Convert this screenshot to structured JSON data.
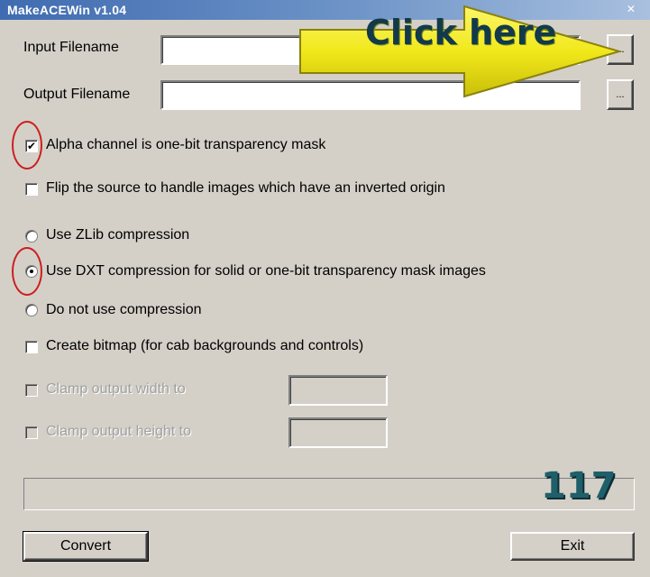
{
  "window": {
    "title": "MakeACEWin v1.04"
  },
  "form": {
    "input_label": "Input Filename",
    "output_label": "Output Filename",
    "browse_label": "...",
    "alpha_label": "Alpha channel is one-bit transparency mask",
    "alpha_checked": true,
    "flip_label": "Flip the source to handle images which have an inverted origin",
    "flip_checked": false,
    "zlib_label": "Use ZLib compression",
    "dxt_label": "Use DXT compression for solid or one-bit transparency mask images",
    "none_label": "Do not use compression",
    "selected_compression": "dxt",
    "bitmap_label": "Create bitmap (for cab backgrounds and controls)",
    "bitmap_checked": false,
    "clamp_width_label": "Clamp output width to",
    "clamp_height_label": "Clamp output height to"
  },
  "buttons": {
    "convert": "Convert",
    "exit": "Exit"
  },
  "overlay": {
    "callout_text": "Click here",
    "page_number": "117",
    "callout_color": "#f5ee1a",
    "highlight_ring_color": "#cc1f1f"
  },
  "icons": {
    "check": "✔"
  }
}
